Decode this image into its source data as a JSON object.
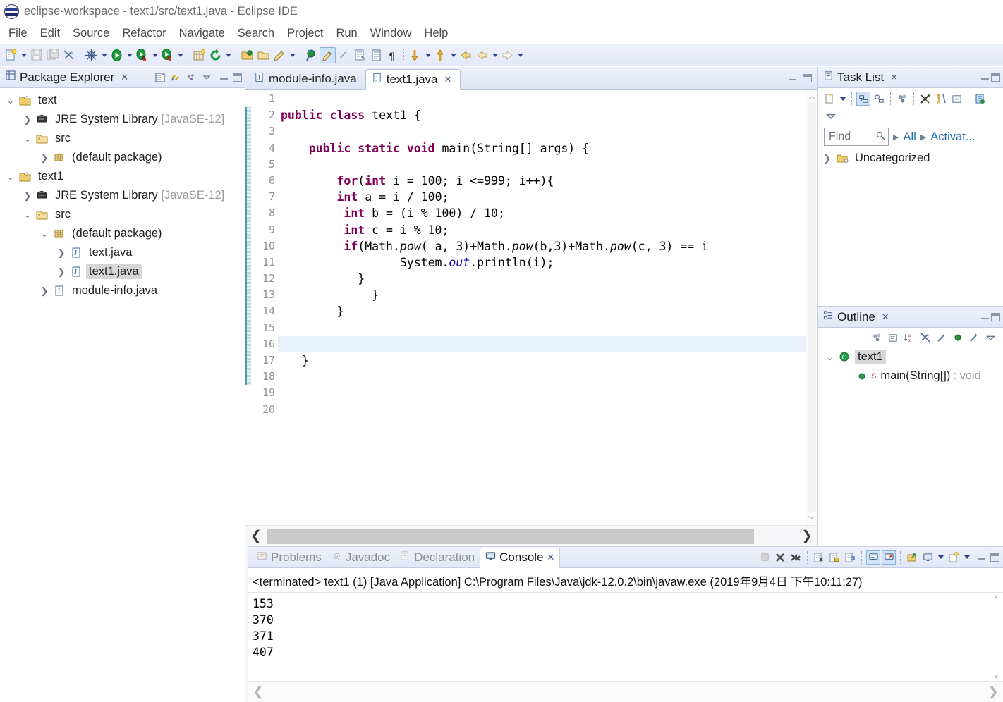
{
  "window": {
    "title": "eclipse-workspace - text1/src/text1.java - Eclipse IDE",
    "icon": "eclipse-logo-icon"
  },
  "menubar": {
    "items": [
      "File",
      "Edit",
      "Source",
      "Refactor",
      "Navigate",
      "Search",
      "Project",
      "Run",
      "Window",
      "Help"
    ]
  },
  "toolbar": {
    "items": [
      {
        "name": "new-wizard-icon",
        "kind": "icon"
      },
      {
        "name": "new-wizard-dropdown-arrow",
        "kind": "arrow"
      },
      {
        "name": "save-icon",
        "kind": "icon"
      },
      {
        "name": "save-all-icon",
        "kind": "icon"
      },
      {
        "name": "toggle-mark-occurrences-icon",
        "kind": "icon"
      },
      {
        "name": "sep",
        "kind": "sep"
      },
      {
        "name": "debug-icon",
        "kind": "icon"
      },
      {
        "name": "debug-dropdown-arrow",
        "kind": "arrow"
      },
      {
        "name": "run-icon",
        "kind": "icon"
      },
      {
        "name": "run-dropdown-arrow",
        "kind": "arrow"
      },
      {
        "name": "run-coverage-icon",
        "kind": "icon"
      },
      {
        "name": "coverage-dropdown-arrow",
        "kind": "arrow"
      },
      {
        "name": "run-external-tools-icon",
        "kind": "icon"
      },
      {
        "name": "external-tools-dropdown-arrow",
        "kind": "arrow"
      },
      {
        "name": "sep",
        "kind": "sep"
      },
      {
        "name": "new-java-project-icon",
        "kind": "icon"
      },
      {
        "name": "refresh-icon",
        "kind": "icon"
      },
      {
        "name": "refresh-dropdown-arrow",
        "kind": "arrow"
      },
      {
        "name": "sep",
        "kind": "sep"
      },
      {
        "name": "open-type-icon",
        "kind": "icon"
      },
      {
        "name": "open-task-icon",
        "kind": "icon"
      },
      {
        "name": "new-java-class-icon",
        "kind": "icon"
      },
      {
        "name": "new-class-dropdown-arrow",
        "kind": "arrow"
      },
      {
        "name": "sep",
        "kind": "sep"
      },
      {
        "name": "search-icon",
        "kind": "icon"
      },
      {
        "name": "last-edit-location-icon",
        "kind": "icon",
        "active": true
      },
      {
        "name": "toggle-block-selection-icon",
        "kind": "icon"
      },
      {
        "name": "next-annotation-icon",
        "kind": "icon"
      },
      {
        "name": "show-whitespace-icon",
        "kind": "icon"
      },
      {
        "name": "paragraph-mark-icon",
        "kind": "icon"
      },
      {
        "name": "sep",
        "kind": "sep"
      },
      {
        "name": "next-annotation-down-icon",
        "kind": "icon"
      },
      {
        "name": "next-annotation-dropdown-arrow",
        "kind": "arrow"
      },
      {
        "name": "previous-annotation-up-icon",
        "kind": "icon"
      },
      {
        "name": "previous-annotation-dropdown-arrow",
        "kind": "arrow"
      },
      {
        "name": "back-history-icon",
        "kind": "icon"
      },
      {
        "name": "back-icon",
        "kind": "icon"
      },
      {
        "name": "back-dropdown-arrow",
        "kind": "arrow"
      },
      {
        "name": "forward-icon",
        "kind": "icon"
      },
      {
        "name": "forward-dropdown-arrow",
        "kind": "arrow"
      }
    ]
  },
  "package_explorer": {
    "title": "Package Explorer",
    "tools": [
      "collapse-all-icon",
      "link-with-editor-icon",
      "view-menu-dots-icon",
      "view-menu-arrow-icon"
    ],
    "tree": [
      {
        "label": "text",
        "icon": "java-project-icon",
        "twisty": "expanded",
        "indent": 0,
        "dim": false,
        "selected": false
      },
      {
        "label": "JRE System Library",
        "suffix": " [JavaSE-12]",
        "icon": "jre-library-icon",
        "twisty": "collapsed",
        "indent": 1,
        "dim": false,
        "selected": false
      },
      {
        "label": "src",
        "icon": "source-folder-icon",
        "twisty": "expanded",
        "indent": 1,
        "dim": false,
        "selected": false
      },
      {
        "label": "(default package)",
        "icon": "package-icon",
        "twisty": "collapsed",
        "indent": 2,
        "dim": false,
        "selected": false
      },
      {
        "label": "text1",
        "icon": "java-project-icon",
        "twisty": "expanded",
        "indent": 0,
        "dim": false,
        "selected": false
      },
      {
        "label": "JRE System Library",
        "suffix": " [JavaSE-12]",
        "icon": "jre-library-icon",
        "twisty": "collapsed",
        "indent": 1,
        "dim": false,
        "selected": false
      },
      {
        "label": "src",
        "icon": "source-folder-icon",
        "twisty": "expanded",
        "indent": 1,
        "dim": false,
        "selected": false
      },
      {
        "label": "(default package)",
        "icon": "package-icon",
        "twisty": "expanded",
        "indent": 2,
        "dim": false,
        "selected": false
      },
      {
        "label": "text.java",
        "icon": "java-file-icon",
        "twisty": "collapsed",
        "indent": 3,
        "dim": false,
        "selected": false
      },
      {
        "label": "text1.java",
        "icon": "java-file-icon",
        "twisty": "collapsed",
        "indent": 3,
        "dim": false,
        "selected": true
      },
      {
        "label": "module-info.java",
        "icon": "java-file-icon",
        "twisty": "collapsed",
        "indent": 2,
        "dim": false,
        "selected": false
      }
    ]
  },
  "editor": {
    "tabs": [
      {
        "label": "module-info.java",
        "icon": "java-file-icon",
        "active": false,
        "closable": false
      },
      {
        "label": "text1.java",
        "icon": "java-file-icon",
        "active": true,
        "closable": true
      }
    ],
    "close_glyph": "✕",
    "line_numbers": [
      "1",
      "2",
      "3",
      "4",
      "5",
      "6",
      "7",
      "8",
      "9",
      "10",
      "11",
      "12",
      "13",
      "14",
      "15",
      "16",
      "17",
      "18",
      "19",
      "20"
    ],
    "fold_marker_line": 4,
    "highlighted_line": 16,
    "lines": [
      {
        "n": 1,
        "tokens": []
      },
      {
        "n": 2,
        "tokens": [
          {
            "t": "kw",
            "v": "public class "
          },
          {
            "t": "plain",
            "v": "text1 {"
          }
        ]
      },
      {
        "n": 3,
        "tokens": []
      },
      {
        "n": 4,
        "tokens": [
          {
            "t": "plain",
            "v": "    "
          },
          {
            "t": "kw",
            "v": "public static void "
          },
          {
            "t": "plain",
            "v": "main(String[] args) {"
          }
        ]
      },
      {
        "n": 5,
        "tokens": []
      },
      {
        "n": 6,
        "tokens": [
          {
            "t": "plain",
            "v": "        "
          },
          {
            "t": "kw",
            "v": "for"
          },
          {
            "t": "plain",
            "v": "("
          },
          {
            "t": "kw",
            "v": "int"
          },
          {
            "t": "plain",
            "v": " i = 100; i <=999; i++){"
          }
        ]
      },
      {
        "n": 7,
        "tokens": [
          {
            "t": "plain",
            "v": "        "
          },
          {
            "t": "kw",
            "v": "int"
          },
          {
            "t": "plain",
            "v": " a = i / 100;"
          }
        ]
      },
      {
        "n": 8,
        "tokens": [
          {
            "t": "plain",
            "v": "         "
          },
          {
            "t": "kw",
            "v": "int"
          },
          {
            "t": "plain",
            "v": " b = (i % 100) / 10;"
          }
        ]
      },
      {
        "n": 9,
        "tokens": [
          {
            "t": "plain",
            "v": "         "
          },
          {
            "t": "kw",
            "v": "int"
          },
          {
            "t": "plain",
            "v": " c = i % 10;"
          }
        ]
      },
      {
        "n": 10,
        "tokens": [
          {
            "t": "plain",
            "v": "         "
          },
          {
            "t": "kw",
            "v": "if"
          },
          {
            "t": "plain",
            "v": "(Math."
          },
          {
            "t": "statm",
            "v": "pow"
          },
          {
            "t": "plain",
            "v": "( a, 3)+Math."
          },
          {
            "t": "statm",
            "v": "pow"
          },
          {
            "t": "plain",
            "v": "(b,3)+Math."
          },
          {
            "t": "statm",
            "v": "pow"
          },
          {
            "t": "plain",
            "v": "(c, 3) == i"
          }
        ]
      },
      {
        "n": 11,
        "tokens": [
          {
            "t": "plain",
            "v": "                 System."
          },
          {
            "t": "stat",
            "v": "out"
          },
          {
            "t": "plain",
            "v": ".println(i);"
          }
        ]
      },
      {
        "n": 12,
        "tokens": [
          {
            "t": "plain",
            "v": "           }"
          }
        ]
      },
      {
        "n": 13,
        "tokens": [
          {
            "t": "plain",
            "v": "             }"
          }
        ]
      },
      {
        "n": 14,
        "tokens": [
          {
            "t": "plain",
            "v": "        }"
          }
        ]
      },
      {
        "n": 15,
        "tokens": []
      },
      {
        "n": 16,
        "tokens": []
      },
      {
        "n": 17,
        "tokens": [
          {
            "t": "plain",
            "v": "   }"
          }
        ]
      },
      {
        "n": 18,
        "tokens": []
      },
      {
        "n": 19,
        "tokens": []
      },
      {
        "n": 20,
        "tokens": []
      }
    ]
  },
  "task_list": {
    "title": "Task List",
    "tools": [
      "new-task-icon",
      "new-task-dropdown-arrow",
      "categorized-presentation-icon",
      "scheduled-presentation-icon",
      "focus-on-workweek-icon",
      "synchronize-changed-icon",
      "show-ui-legend-icon",
      "collapse-all-icon",
      "view-menu-icon",
      "view-menu-arrow-icon"
    ],
    "find_placeholder": "Find",
    "find_value": "",
    "search_icon": "search-icon",
    "breadcrumbs": [
      "All",
      "Activat..."
    ],
    "items": [
      {
        "label": "Uncategorized",
        "icon": "uncategorized-folder-icon",
        "twisty": "collapsed"
      }
    ]
  },
  "outline": {
    "title": "Outline",
    "tools": [
      "focus-on-active-task-icon",
      "collapse-all-icon",
      "sort-icon",
      "hide-fields-icon",
      "hide-static-icon",
      "hide-nonpublic-icon",
      "hide-local-types-icon",
      "view-menu-arrow-icon"
    ],
    "items": [
      {
        "label": "text1",
        "icon": "java-class-icon",
        "twisty": "expanded",
        "indent": 0,
        "selected": true,
        "suffix": ""
      },
      {
        "label": "main(String[])",
        "icon": "public-method-icon",
        "badge": "S",
        "twisty": "none",
        "indent": 1,
        "selected": false,
        "suffix": " : void"
      }
    ]
  },
  "console": {
    "tabs": [
      {
        "label": "Problems",
        "icon": "problems-icon",
        "active": false,
        "closable": false
      },
      {
        "label": "Javadoc",
        "icon": "javadoc-icon",
        "active": false,
        "closable": false
      },
      {
        "label": "Declaration",
        "icon": "declaration-icon",
        "active": false,
        "closable": false
      },
      {
        "label": "Console",
        "icon": "console-icon",
        "active": true,
        "closable": true
      }
    ],
    "close_glyph": "✕",
    "tools": [
      "terminate-disabled-icon",
      "remove-launch-icon",
      "remove-all-terminated-icon",
      "clear-console-icon",
      "scroll-lock-icon",
      "word-wrap-icon",
      "show-console-on-output-icon",
      "pin-console-icon",
      "display-selected-console-icon",
      "display-console-dropdown-arrow",
      "open-console-icon",
      "open-console-dropdown-arrow",
      "minimize-icon",
      "maximize-icon"
    ],
    "header": "<terminated> text1 (1) [Java Application] C:\\Program Files\\Java\\jdk-12.0.2\\bin\\javaw.exe (2019年9月4日 下午10:11:27)",
    "output": [
      "153",
      "370",
      "371",
      "407"
    ]
  },
  "scrollbars": {
    "left_arrow": "❮",
    "right_arrow": "❯",
    "up_arrow": "︿",
    "down_arrow": "﹀"
  },
  "colors": {
    "keyword": "#7f0055",
    "static_field": "#0000c0",
    "toolbar_bg": "#e7ecf8",
    "selection": "#d6d6d6",
    "current_line": "#e8f0fb",
    "link": "#1d6ab5"
  }
}
